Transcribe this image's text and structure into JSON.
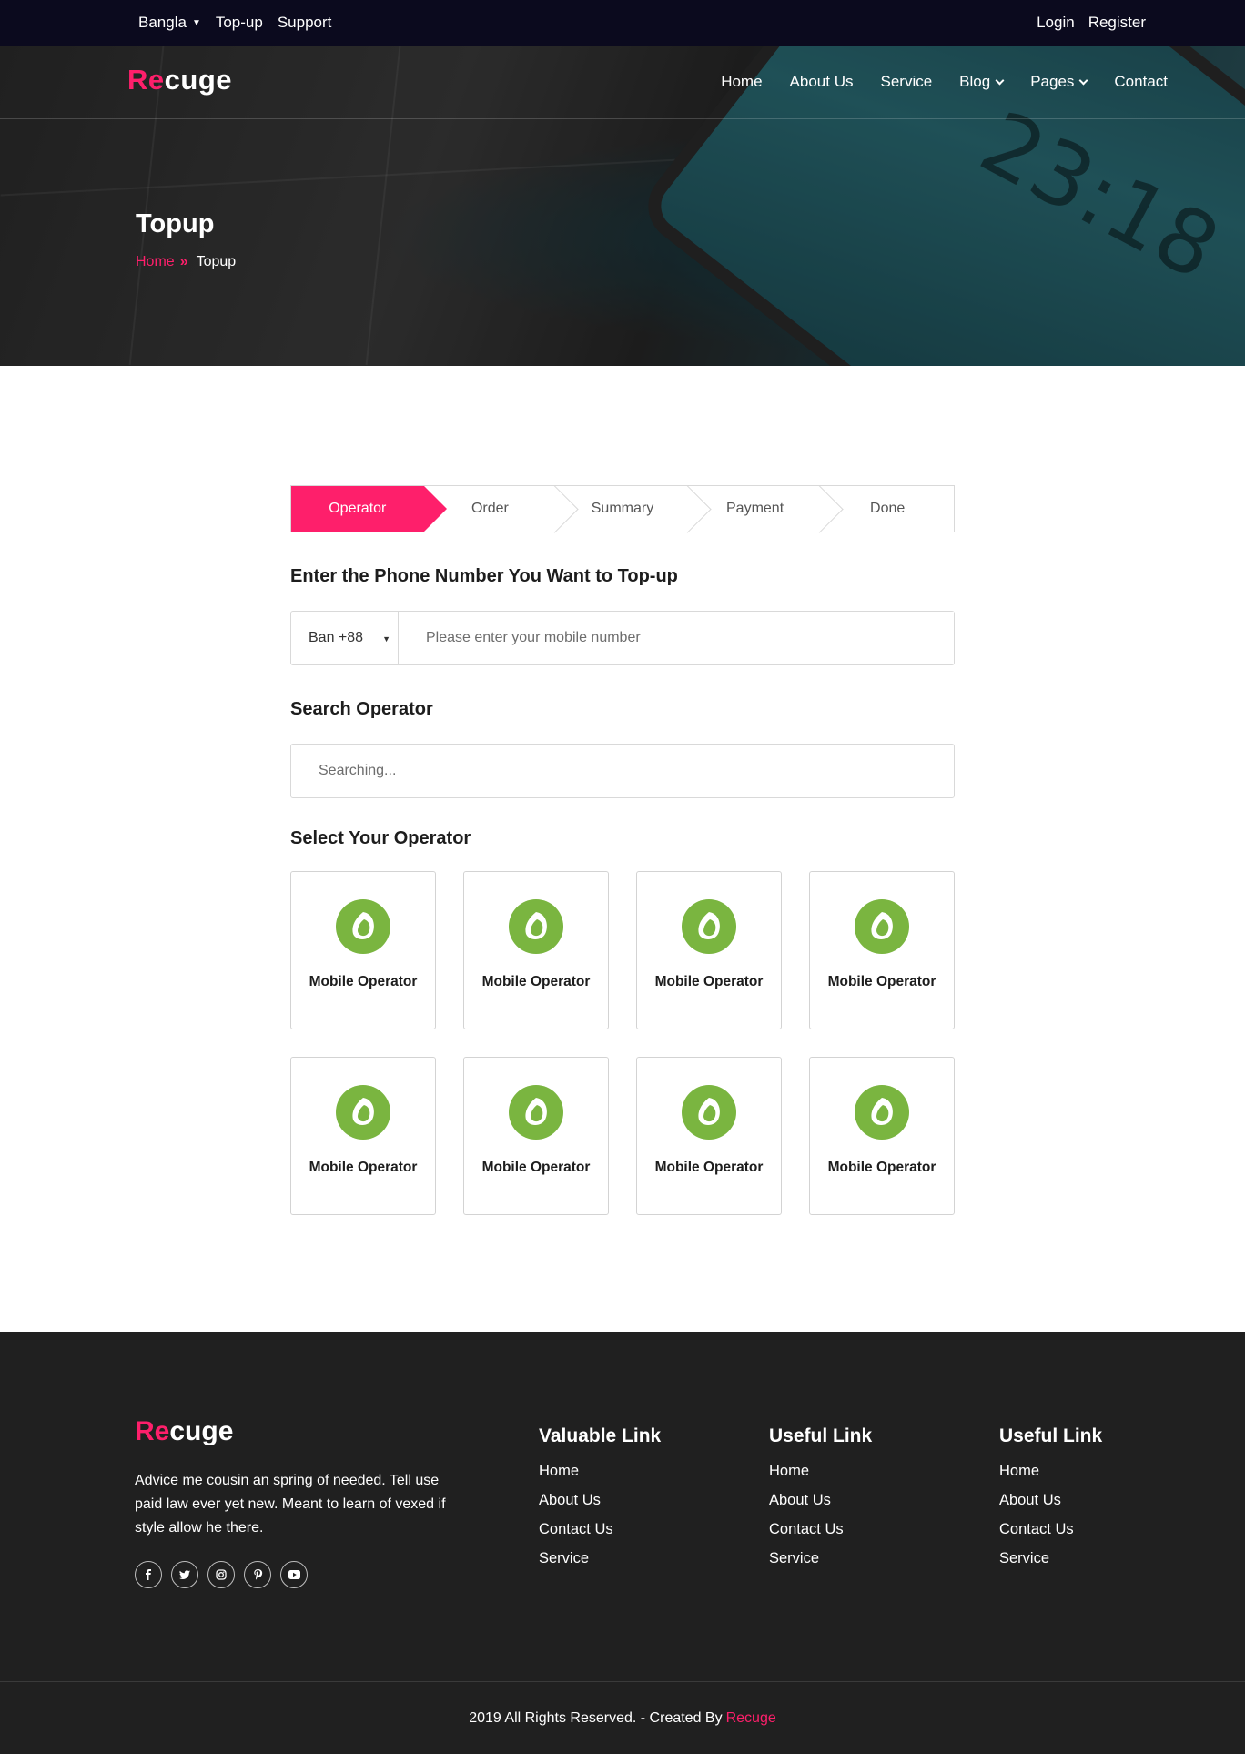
{
  "topbar": {
    "language": "Bangla",
    "topup": "Top-up",
    "support": "Support",
    "login": "Login",
    "register": "Register"
  },
  "brand": {
    "accent": "Re",
    "rest": "cuge"
  },
  "nav": {
    "items": [
      "Home",
      "About Us",
      "Service",
      "Blog",
      "Pages",
      "Contact"
    ]
  },
  "hero": {
    "title": "Topup",
    "breadcrumb_home": "Home",
    "breadcrumb_sep": "»",
    "breadcrumb_current": "Topup",
    "clock_text": "23:18"
  },
  "steps": [
    "Operator",
    "Order",
    "Summary",
    "Payment",
    "Done"
  ],
  "phone_section": {
    "heading": "Enter the Phone Number You Want to Top-up",
    "country_code": "Ban +88",
    "placeholder": "Please enter your mobile number"
  },
  "search_section": {
    "heading": "Search Operator",
    "placeholder": "Searching..."
  },
  "operators_section": {
    "heading": "Select Your Operator",
    "operators": [
      "Mobile Operator",
      "Mobile Operator",
      "Mobile Operator",
      "Mobile Operator",
      "Mobile Operator",
      "Mobile Operator",
      "Mobile Operator",
      "Mobile Operator"
    ]
  },
  "footer": {
    "about": "Advice me cousin an spring of needed. Tell use paid law ever yet new. Meant to learn of vexed if style allow he there.",
    "social_icons": [
      "facebook-icon",
      "twitter-icon",
      "instagram-icon",
      "pinterest-icon",
      "youtube-icon"
    ],
    "col1": {
      "title": "Valuable Link",
      "links": [
        "Home",
        "About Us",
        "Contact Us",
        "Service"
      ]
    },
    "col2": {
      "title": "Useful Link",
      "links": [
        "Home",
        "About Us",
        "Contact Us",
        "Service"
      ]
    },
    "col3": {
      "title": "Useful Link",
      "links": [
        "Home",
        "About Us",
        "Contact Us",
        "Service"
      ]
    },
    "copyright": "2019 All Rights Reserved. - Created By",
    "copyright_brand": "Recuge"
  },
  "colors": {
    "accent": "#fe1f6b",
    "topbar": "#0b0a1e",
    "footer": "#202020",
    "operator_green": "#7ab540"
  }
}
